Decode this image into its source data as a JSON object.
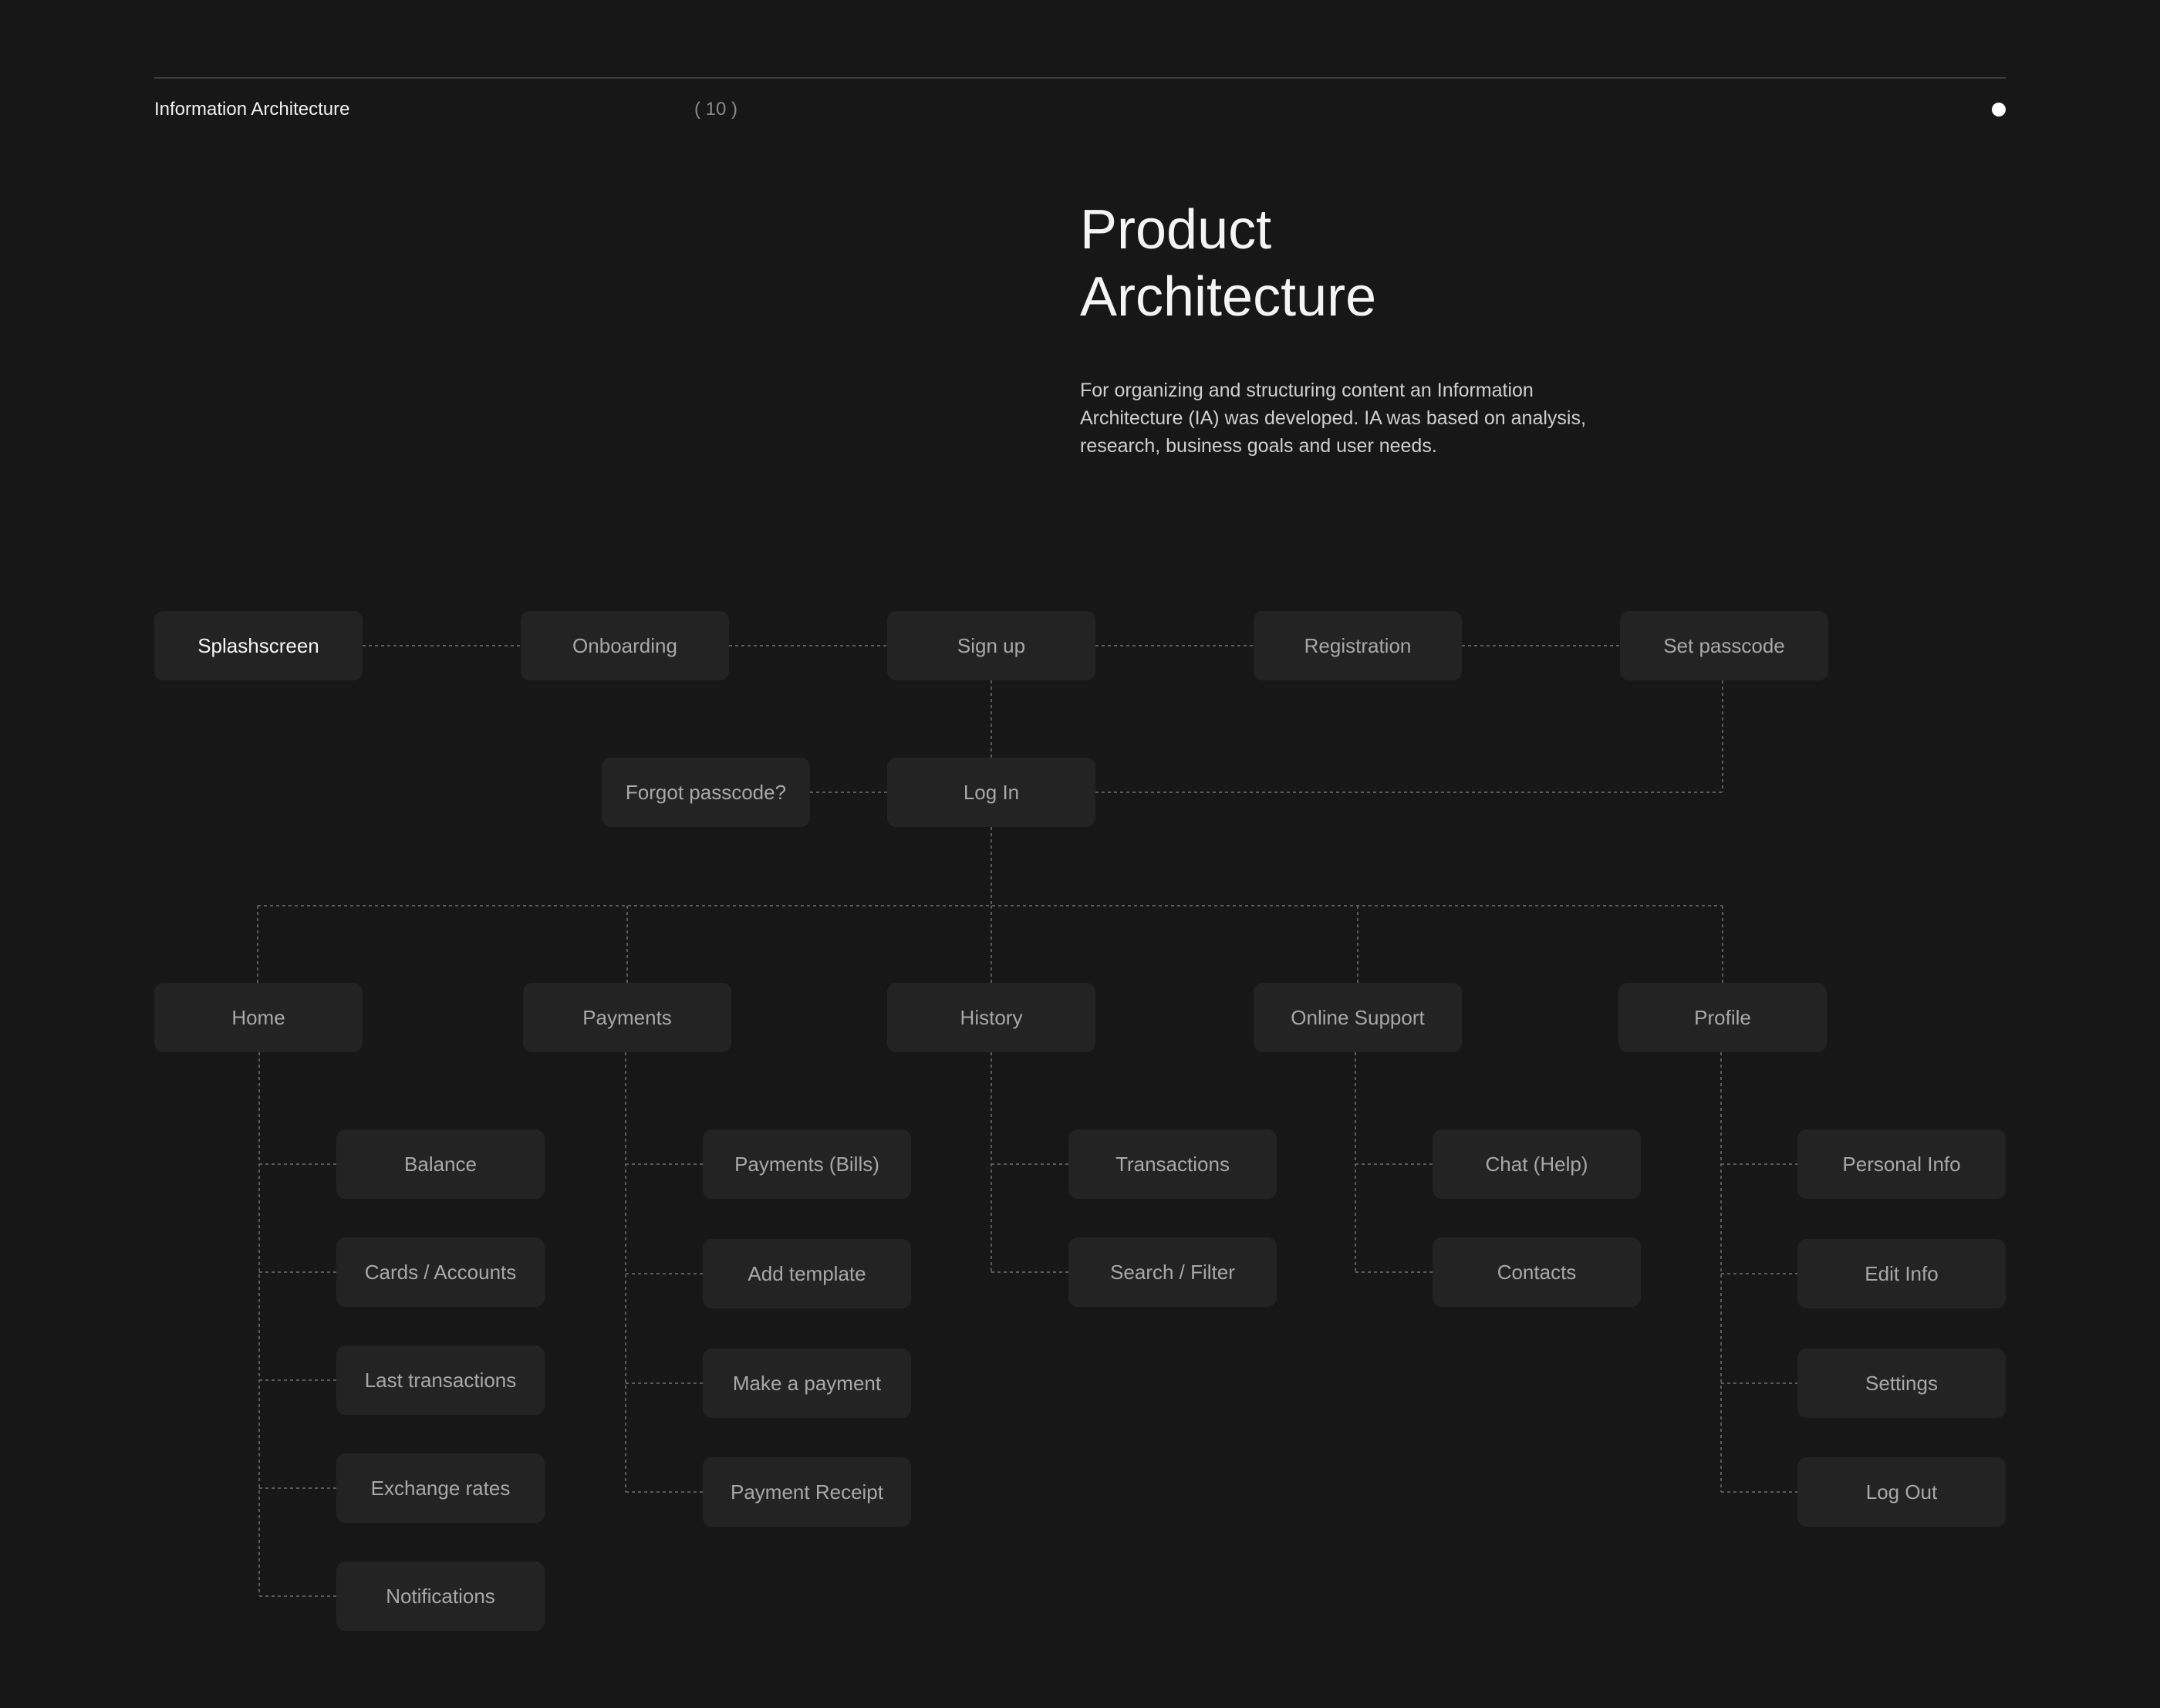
{
  "header": {
    "section_label": "Information Architecture",
    "page_number": "( 10 )"
  },
  "title": "Product\nArchitecture",
  "description": "For organizing and structuring content an Information Architecture (IA) was developed. IA was based on analysis, research, business goals and user needs.",
  "diagram": {
    "flow": [
      "Splashscreen",
      "Onboarding",
      "Sign up",
      "Registration",
      "Set passcode"
    ],
    "login": "Log In",
    "forgot": "Forgot passcode?",
    "sections": [
      {
        "label": "Home",
        "children": [
          "Balance",
          "Cards / Accounts",
          "Last transactions",
          "Exchange rates",
          "Notifications"
        ]
      },
      {
        "label": "Payments",
        "children": [
          "Payments (Bills)",
          "Add template",
          "Make a payment",
          "Payment Receipt"
        ]
      },
      {
        "label": "History",
        "children": [
          "Transactions",
          "Search / Filter"
        ]
      },
      {
        "label": "Online Support",
        "children": [
          "Chat (Help)",
          "Contacts"
        ]
      },
      {
        "label": "Profile",
        "children": [
          "Personal Info",
          "Edit Info",
          "Settings",
          "Log Out"
        ]
      }
    ]
  },
  "colors": {
    "background": "#171717",
    "node": "#232323",
    "connector": "#5a5a5a",
    "text_active": "#f5f5f5",
    "text_muted": "#a8a8a8"
  }
}
